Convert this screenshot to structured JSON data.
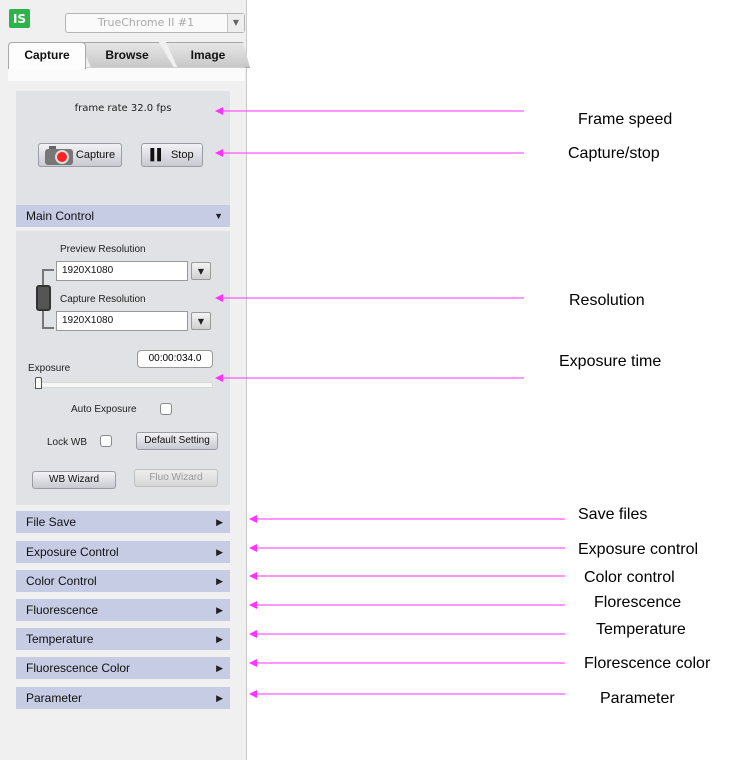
{
  "app": {
    "logo_text": "IS",
    "camera": "TrueChrome II #1"
  },
  "tabs": [
    "Capture",
    "Browse",
    "Image"
  ],
  "capture": {
    "fps": "frame rate 32.0 fps",
    "capture_label": "Capture",
    "stop_label": "Stop"
  },
  "main_control": {
    "title": "Main Control",
    "preview_label": "Preview Resolution",
    "preview_value": "1920X1080",
    "capture_label": "Capture Resolution",
    "capture_value": "1920X1080",
    "exposure_label": "Exposure",
    "exposure_value": "00:00:034.0",
    "exposure_slider_fraction": 0.02,
    "auto_exposure_label": "Auto Exposure",
    "auto_exposure_checked": false,
    "lock_wb_label": "Lock WB",
    "lock_wb_checked": false,
    "default_setting_label": "Default Setting",
    "wb_wizard_label": "WB Wizard",
    "fluo_wizard_label": "Fluo Wizard"
  },
  "sections": [
    "File Save",
    "Exposure Control",
    "Color Control",
    "Fluorescence",
    "Temperature",
    "Fluorescence Color",
    "Parameter"
  ],
  "annotations": {
    "frame_speed": "Frame speed",
    "capture_stop": "Capture/stop",
    "resolution": "Resolution",
    "exposure_time": "Exposure time",
    "save_files": "Save files",
    "exposure_control": "Exposure control",
    "color_control": "Color control",
    "florescence": "Florescence",
    "temperature": "Temperature",
    "florescence_color": "Florescence color",
    "parameter": "Parameter"
  },
  "colors": {
    "accent_arrow": "#ff33ff",
    "section_header": "#c5cce3",
    "panel_bg": "#e1e2e6",
    "logo": "#2db34a"
  }
}
